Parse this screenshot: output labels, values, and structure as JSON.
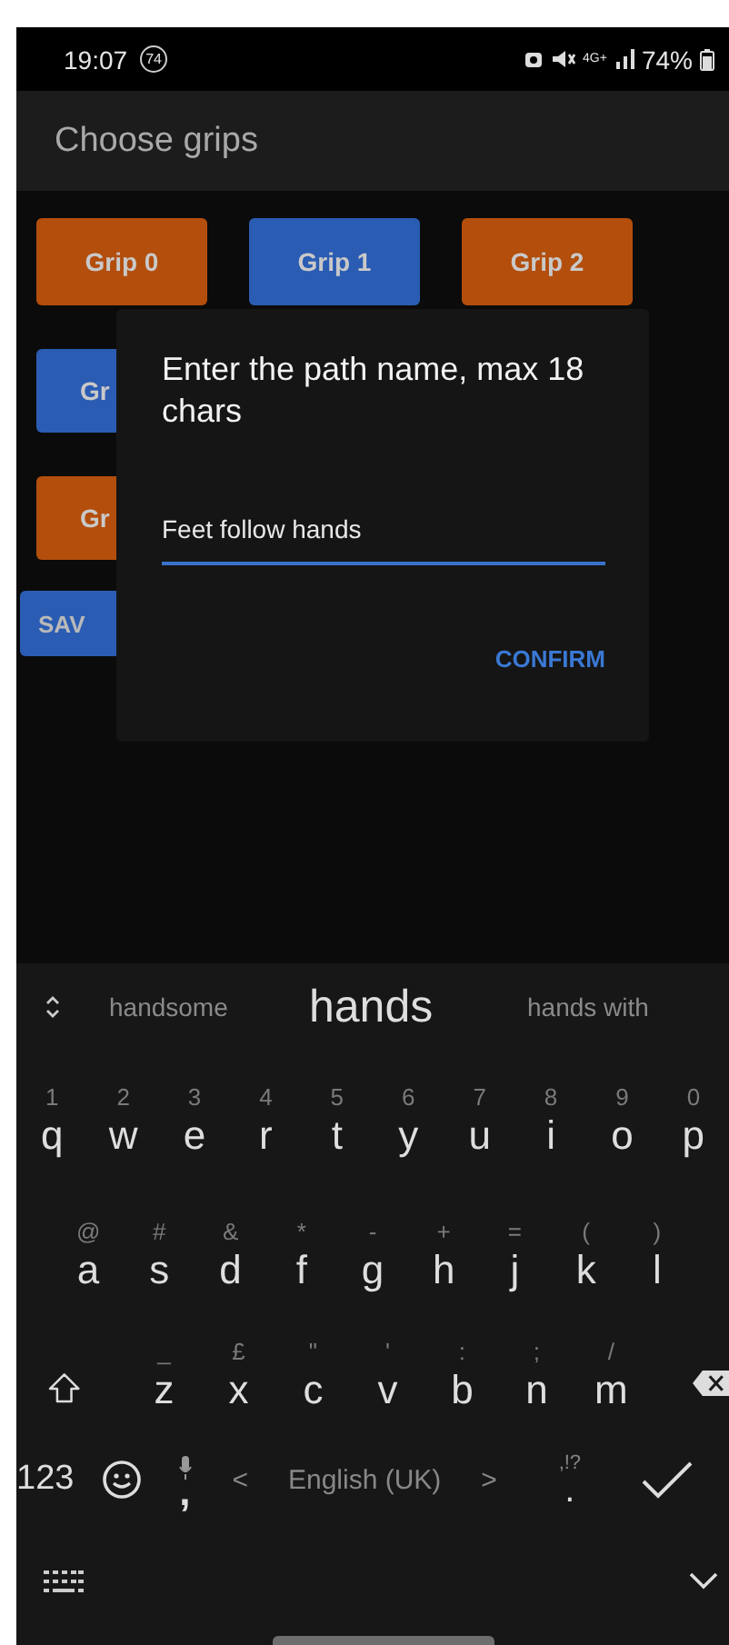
{
  "status_bar": {
    "time": "19:07",
    "badge": "74",
    "network": "4G+",
    "battery": "74%"
  },
  "app_bar": {
    "title": "Choose grips"
  },
  "grip_rows": [
    [
      {
        "label": "Grip 0",
        "color": "#b34e0c"
      },
      {
        "label": "Grip 1",
        "color": "#2b5cb3"
      },
      {
        "label": "Grip 2",
        "color": "#b34e0c"
      }
    ],
    [
      {
        "label": "Gr",
        "color": "#2b5cb3"
      }
    ],
    [
      {
        "label": "Gr",
        "color": "#b34e0c"
      }
    ]
  ],
  "save_button": {
    "label": "SAV"
  },
  "dialog": {
    "title": "Enter the path name, max 18 chars",
    "value": "Feet follow hands",
    "confirm": "CONFIRM"
  },
  "keyboard": {
    "suggestions": [
      {
        "text": "handsome",
        "selected": false
      },
      {
        "text": "hands",
        "selected": true
      },
      {
        "text": "hands with",
        "selected": false
      }
    ],
    "rows": [
      [
        {
          "key": "q",
          "hint": "1"
        },
        {
          "key": "w",
          "hint": "2"
        },
        {
          "key": "e",
          "hint": "3"
        },
        {
          "key": "r",
          "hint": "4"
        },
        {
          "key": "t",
          "hint": "5"
        },
        {
          "key": "y",
          "hint": "6"
        },
        {
          "key": "u",
          "hint": "7"
        },
        {
          "key": "i",
          "hint": "8"
        },
        {
          "key": "o",
          "hint": "9"
        },
        {
          "key": "p",
          "hint": "0"
        }
      ],
      [
        {
          "key": "a",
          "hint": "@"
        },
        {
          "key": "s",
          "hint": "#"
        },
        {
          "key": "d",
          "hint": "&"
        },
        {
          "key": "f",
          "hint": "*"
        },
        {
          "key": "g",
          "hint": "-"
        },
        {
          "key": "h",
          "hint": "+"
        },
        {
          "key": "j",
          "hint": "="
        },
        {
          "key": "k",
          "hint": "("
        },
        {
          "key": "l",
          "hint": ")"
        }
      ],
      [
        {
          "key": "z",
          "hint": "_"
        },
        {
          "key": "x",
          "hint": "£"
        },
        {
          "key": "c",
          "hint": "\""
        },
        {
          "key": "v",
          "hint": "'"
        },
        {
          "key": "b",
          "hint": ":"
        },
        {
          "key": "n",
          "hint": ";"
        },
        {
          "key": "m",
          "hint": "/"
        }
      ]
    ],
    "symbols_key": "123",
    "comma": ",",
    "space": {
      "prev": "<",
      "language": "English (UK)",
      "next": ">"
    },
    "period": ".",
    "period_hint": ",!?"
  }
}
